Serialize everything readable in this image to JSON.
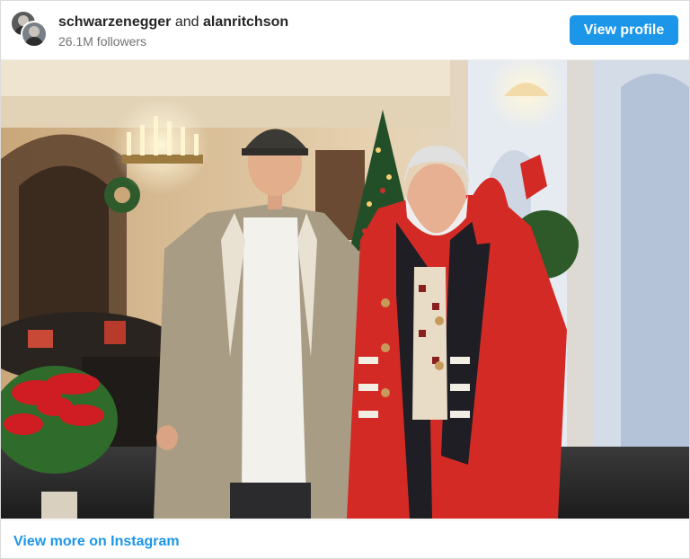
{
  "header": {
    "user1": "schwarzenegger",
    "connector": "and",
    "user2": "alanritchson",
    "followers": "26.1M followers",
    "view_profile_label": "View profile"
  },
  "footer": {
    "view_more_label": "View more on Instagram"
  },
  "colors": {
    "accent": "#1c96e8",
    "coat_red": "#d42a25",
    "coat_beige": "#a99c84"
  }
}
